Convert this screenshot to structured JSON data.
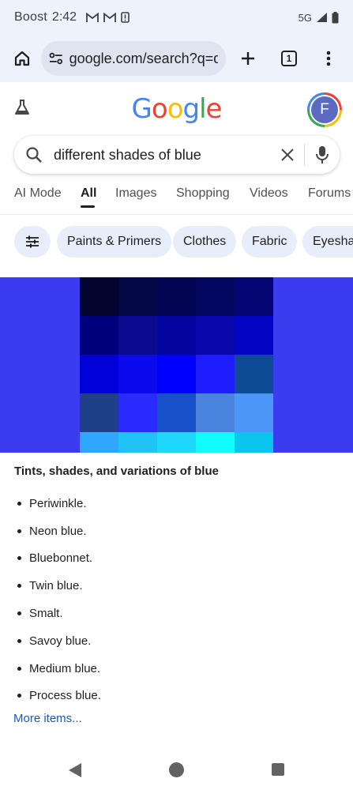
{
  "status_bar": {
    "carrier": "Boost",
    "time": "2:42",
    "network": "5G",
    "notification_icons": [
      "gmail-icon",
      "gmail-icon",
      "sim-alert-icon"
    ]
  },
  "browser": {
    "url": "google.com/search?q=d",
    "tab_count": "1"
  },
  "google": {
    "logo_letters": [
      {
        "ch": "G",
        "color": "#4285f4"
      },
      {
        "ch": "o",
        "color": "#ea4335"
      },
      {
        "ch": "o",
        "color": "#fbbc05"
      },
      {
        "ch": "g",
        "color": "#4285f4"
      },
      {
        "ch": "l",
        "color": "#34a853"
      },
      {
        "ch": "e",
        "color": "#ea4335"
      }
    ],
    "avatar_letter": "F"
  },
  "search": {
    "query": "different shades of blue"
  },
  "tabs": [
    {
      "label": "AI Mode",
      "active": false
    },
    {
      "label": "All",
      "active": true
    },
    {
      "label": "Images",
      "active": false
    },
    {
      "label": "Shopping",
      "active": false
    },
    {
      "label": "Videos",
      "active": false
    },
    {
      "label": "Forums",
      "active": false
    }
  ],
  "chips": [
    "Paints & Primers",
    "Clothes",
    "Fabric",
    "Eyeshad"
  ],
  "image": {
    "background": "#3b3bf0",
    "swatch_colors": [
      "#03052f",
      "#050846",
      "#040552",
      "#05065f",
      "#040572",
      "#01017d",
      "#0a0a8e",
      "#0505a0",
      "#0808ad",
      "#0404c5",
      "#0000d8",
      "#0a0aec",
      "#0000ff",
      "#1d1dff",
      "#0e4a95",
      "#1f3f88",
      "#2a2cff",
      "#1651c9",
      "#4a83de",
      "#4b96f6",
      "#30a6ff",
      "#1fc3f4",
      "#1ed7fa",
      "#10fbfb",
      "#0ac5ee"
    ]
  },
  "snippet": {
    "title": "Tints, shades, and variations of blue",
    "items": [
      "Periwinkle.",
      "Neon blue.",
      "Bluebonnet.",
      "Twin blue.",
      "Smalt.",
      "Savoy blue.",
      "Medium blue.",
      "Process blue."
    ],
    "more_link": "More items..."
  },
  "colors": {
    "link": "#1a56c9",
    "chip_bg": "#e8eef9",
    "toolbar_bg": "#eef2fb"
  }
}
